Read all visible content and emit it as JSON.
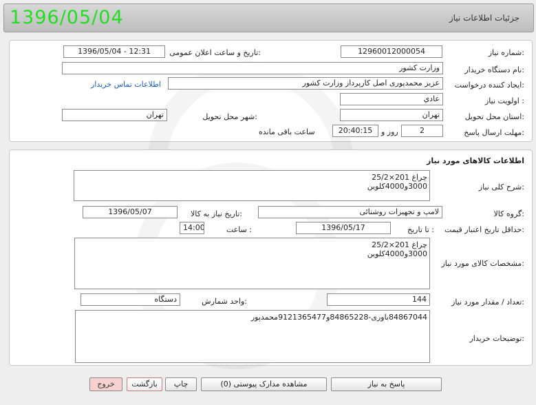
{
  "header": {
    "title": "جزئیات اطلاعات نیاز",
    "date": "1396/05/04"
  },
  "info": {
    "need_number_label": "شماره نیاز:",
    "need_number": "12960012000054",
    "announce_label": "تاریخ و ساعت اعلان عمومی:",
    "announce_value": "1396/05/04 - 12:31",
    "buyer_org_label": "نام دستگاه خریدار:",
    "buyer_org": "وزارت کشور",
    "creator_label": "ایجاد کننده درخواست:",
    "creator": "عزیز محمدپوری اصل کارپرداز وزارت کشور",
    "contact_link": "اطلاعات تماس خریدار",
    "priority_label": "اولویت نیاز :",
    "priority": "عادي",
    "province_label": "استان محل تحویل:",
    "province": "تهران",
    "city_label": "شهر محل تحویل:",
    "city": "تهران",
    "deadline_label": "مهلت ارسال پاسخ:",
    "deadline_days": "2",
    "day_and": "روز و",
    "deadline_time": "20:40:15",
    "remaining": "ساعت باقی مانده"
  },
  "goods": {
    "section_title": "اطلاعات کالاهای مورد نیاز",
    "summary_label": "شرح کلی نیاز:",
    "summary": "چراغ 201×25/2\n3000و4000کلوین",
    "group_label": "گروه کالا:",
    "group": "لامپ و تجهیزات روشنائی",
    "need_date_label": "تاریخ نیاز به کالا:",
    "need_date": "1396/05/07",
    "min_valid_label": "حداقل تاریخ اعتبار قیمت:",
    "until_date_label": "تا تاریخ :",
    "until_date": "1396/05/17",
    "time_label": "ساعت :",
    "time": "14:00",
    "specs_label": "مشخصات کالای مورد نیاز:",
    "specs": "چراغ 201×25/2\n3000و4000کلوین",
    "qty_label": "تعداد / مقدار مورد نیاز:",
    "qty": "144",
    "unit_label": "واحد شمارش:",
    "unit": "دستگاه",
    "notes_label": "توضیحات خریدار:",
    "notes": "84867044باوری-84865228و9121365477محمدپور"
  },
  "buttons": {
    "reply": "پاسخ به نیاز",
    "attachments": "مشاهده مدارک پیوستی (0)",
    "print": "چاپ",
    "back": "بازگشت",
    "exit": "خروج"
  }
}
